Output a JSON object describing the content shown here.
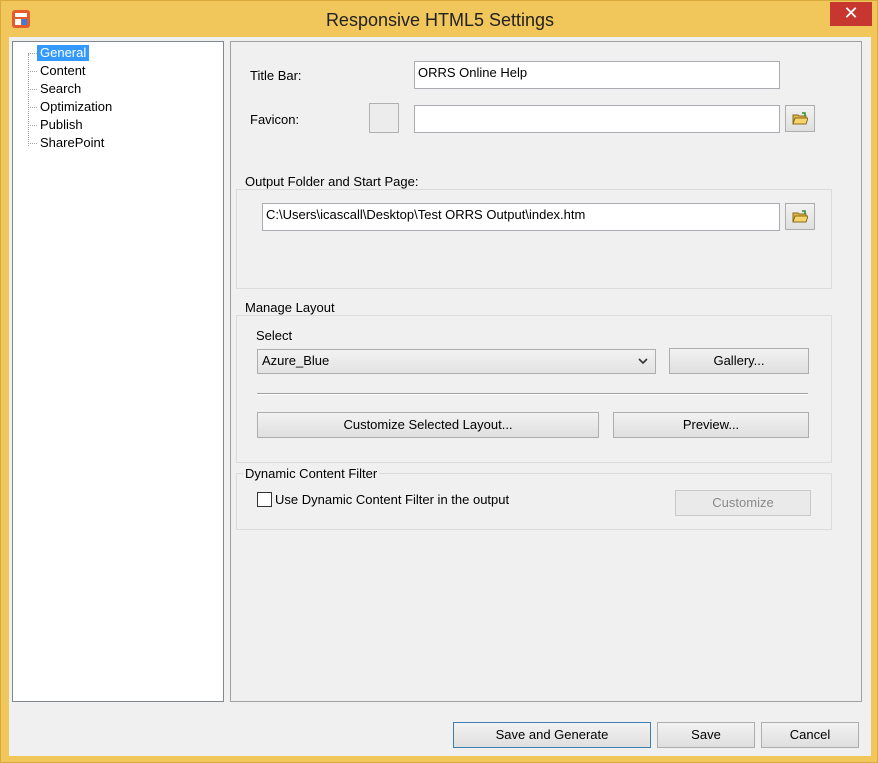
{
  "window": {
    "title": "Responsive HTML5 Settings",
    "close_glyph": "✕"
  },
  "tree": {
    "items": [
      {
        "label": "General",
        "selected": true
      },
      {
        "label": "Content",
        "selected": false
      },
      {
        "label": "Search",
        "selected": false
      },
      {
        "label": "Optimization",
        "selected": false
      },
      {
        "label": "Publish",
        "selected": false
      },
      {
        "label": "SharePoint",
        "selected": false
      }
    ]
  },
  "general": {
    "title_bar_label": "Title Bar:",
    "title_bar_value": "ORRS Online Help",
    "favicon_label": "Favicon:",
    "favicon_value": ""
  },
  "output": {
    "group_title": "Output Folder and Start Page:",
    "path_value": "C:\\Users\\icascall\\Desktop\\Test ORRS Output\\index.htm"
  },
  "layout": {
    "group_title": "Manage Layout",
    "select_label": "Select",
    "selected_layout": "Azure_Blue",
    "gallery_label": "Gallery...",
    "customize_label": "Customize Selected Layout...",
    "preview_label": "Preview..."
  },
  "filter": {
    "group_title": "Dynamic Content Filter",
    "checkbox_label": "Use Dynamic Content Filter in the output",
    "checked": false,
    "customize_label": "Customize"
  },
  "footer": {
    "save_generate_label": "Save and Generate",
    "save_label": "Save",
    "cancel_label": "Cancel"
  },
  "icons": {
    "app": "app-logo-icon",
    "folder": "open-folder-icon",
    "dropdown": "chevron-down-icon"
  },
  "colors": {
    "window_frame": "#f1c65b",
    "close_button": "#c7372f",
    "selection": "#3399ff"
  }
}
